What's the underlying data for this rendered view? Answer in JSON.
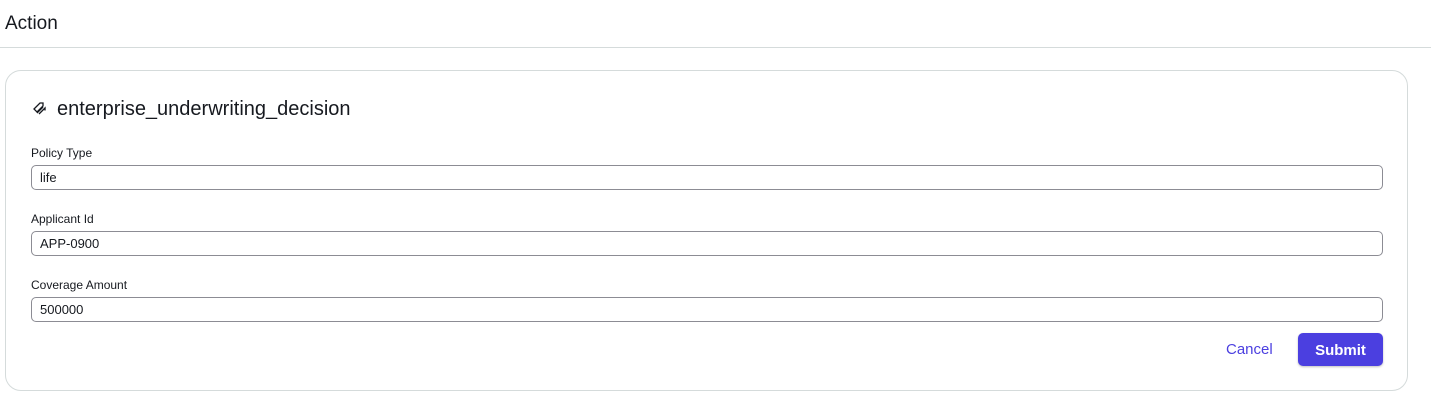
{
  "header": {
    "title": "Action"
  },
  "card": {
    "icon": "action-tag-icon",
    "title": "enterprise_underwriting_decision"
  },
  "fields": [
    {
      "label": "Policy Type",
      "value": "life"
    },
    {
      "label": "Applicant Id",
      "value": "APP-0900"
    },
    {
      "label": "Coverage Amount",
      "value": "500000"
    }
  ],
  "actions": {
    "cancel_label": "Cancel",
    "submit_label": "Submit"
  },
  "colors": {
    "accent": "#4b3fe0",
    "border": "#d5dbdb",
    "input_border": "#8c8c94"
  }
}
